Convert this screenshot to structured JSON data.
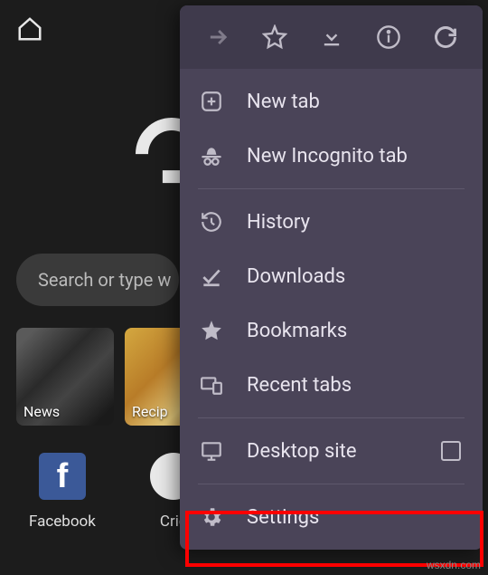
{
  "search": {
    "placeholder": "Search or type w"
  },
  "tiles": {
    "news": "News",
    "recipes": "Recip"
  },
  "apps": {
    "facebook": "Facebook",
    "cricbuzz": "Cric"
  },
  "menu": {
    "new_tab": "New tab",
    "new_incognito": "New Incognito tab",
    "history": "History",
    "downloads": "Downloads",
    "bookmarks": "Bookmarks",
    "recent_tabs": "Recent tabs",
    "desktop_site": "Desktop site",
    "settings": "Settings"
  },
  "watermark": "wsxdn.com"
}
